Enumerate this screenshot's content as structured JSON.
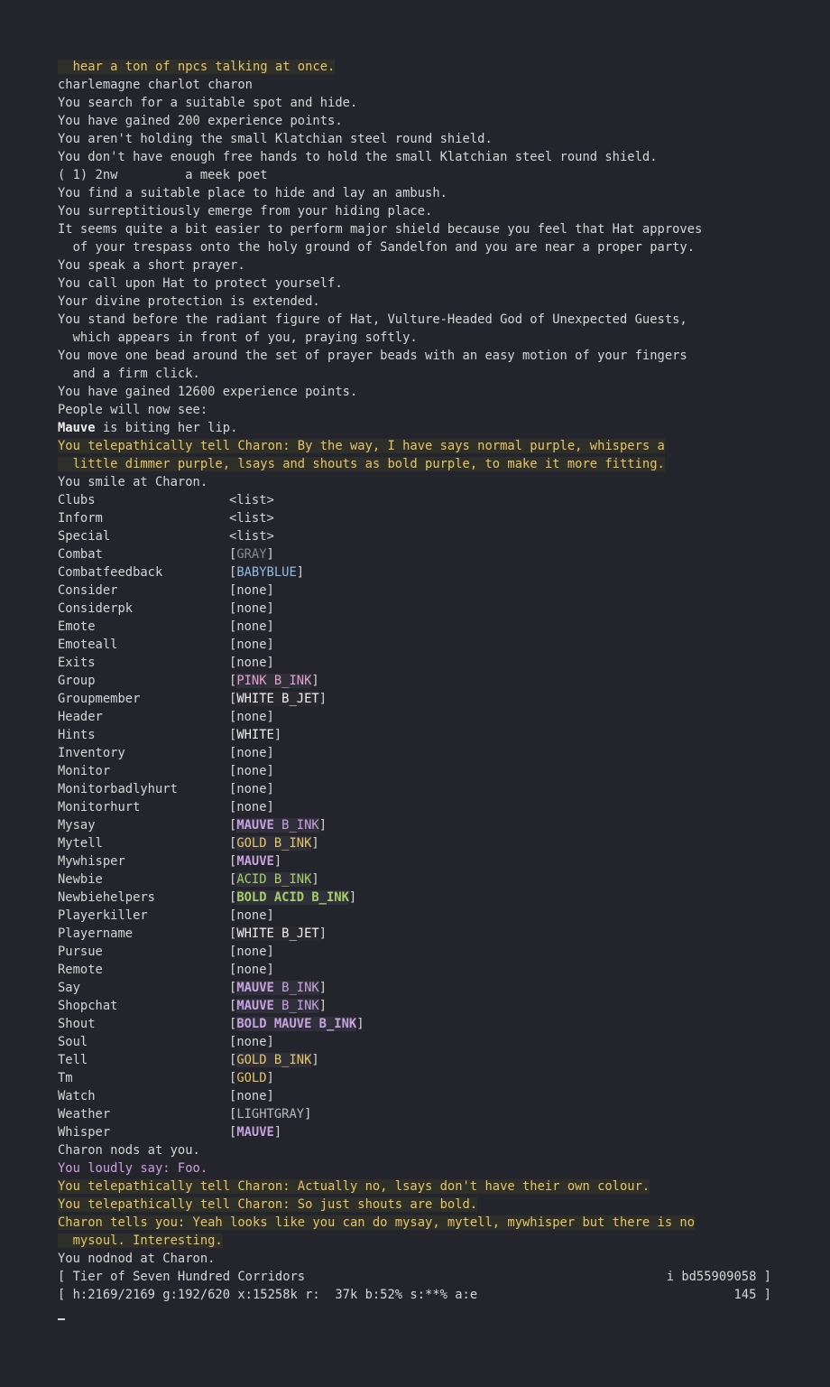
{
  "lines_top": [
    {
      "text": "  hear a ton of npcs talking at once.",
      "cls": "gold hl"
    },
    {
      "text": "charlemagne charlot charon",
      "cls": ""
    },
    {
      "text": "You search for a suitable spot and hide.",
      "cls": ""
    },
    {
      "text": "You have gained 200 experience points.",
      "cls": ""
    },
    {
      "text": "You aren't holding the small Klatchian steel round shield.",
      "cls": ""
    },
    {
      "text": "You don't have enough free hands to hold the small Klatchian steel round shield.",
      "cls": ""
    },
    {
      "text": "( 1) 2nw         a meek poet",
      "cls": ""
    },
    {
      "text": "You find a suitable place to hide and lay an ambush.",
      "cls": ""
    },
    {
      "text": "You surreptitiously emerge from your hiding place.",
      "cls": ""
    },
    {
      "text": "It seems quite a bit easier to perform major shield because you feel that Hat approves",
      "cls": ""
    },
    {
      "text": "  of your trespass onto the holy ground of Sandelfon and you are near a proper party.",
      "cls": ""
    },
    {
      "text": "You speak a short prayer.",
      "cls": ""
    },
    {
      "text": "You call upon Hat to protect yourself.",
      "cls": ""
    },
    {
      "text": "Your divine protection is extended.",
      "cls": ""
    },
    {
      "text": "You stand before the radiant figure of Hat, Vulture-Headed God of Unexpected Guests,",
      "cls": ""
    },
    {
      "text": "  which appears in front of you, praying softly.",
      "cls": ""
    },
    {
      "text": "You move one bead around the set of prayer beads with an easy motion of your fingers",
      "cls": ""
    },
    {
      "text": "  and a firm click.",
      "cls": ""
    },
    {
      "text": "You have gained 12600 experience points.",
      "cls": ""
    },
    {
      "text": "People will now see:",
      "cls": ""
    }
  ],
  "mauve_line": {
    "name": "Mauve",
    "rest": " is biting her lip."
  },
  "lines_mid": [
    {
      "text": "You telepathically tell Charon: By the way, I have says normal purple, whispers a",
      "cls": "gold hl"
    },
    {
      "text": "  little dimmer purple, lsays and shouts as bold purple, to make it more fitting.",
      "cls": "gold hl"
    },
    {
      "text": "You smile at Charon.",
      "cls": ""
    }
  ],
  "config": [
    {
      "name": "Clubs",
      "value": "<list>",
      "cls": "",
      "bracket": false
    },
    {
      "name": "Inform",
      "value": "<list>",
      "cls": "",
      "bracket": false
    },
    {
      "name": "Special",
      "value": "<list>",
      "cls": "",
      "bracket": false
    },
    {
      "name": "Combat",
      "value": "GRAY",
      "cls": "gray",
      "bracket": true
    },
    {
      "name": "Combatfeedback",
      "value": "BABYBLUE",
      "cls": "babyblue",
      "bracket": true
    },
    {
      "name": "Consider",
      "value": "none",
      "cls": "",
      "bracket": true
    },
    {
      "name": "Considerpk",
      "value": "none",
      "cls": "",
      "bracket": true
    },
    {
      "name": "Emote",
      "value": "none",
      "cls": "",
      "bracket": true
    },
    {
      "name": "Emoteall",
      "value": "none",
      "cls": "",
      "bracket": true
    },
    {
      "name": "Exits",
      "value": "none",
      "cls": "",
      "bracket": true
    },
    {
      "name": "Group",
      "value": "PINK B_INK",
      "cls": "pink b_ink",
      "bracket": true
    },
    {
      "name": "Groupmember",
      "value": "WHITE B_JET",
      "cls": "white b_jet",
      "bracket": true
    },
    {
      "name": "Header",
      "value": "none",
      "cls": "",
      "bracket": true
    },
    {
      "name": "Hints",
      "value": "WHITE",
      "cls": "white",
      "bracket": true
    },
    {
      "name": "Inventory",
      "value": "none",
      "cls": "",
      "bracket": true
    },
    {
      "name": "Monitor",
      "value": "none",
      "cls": "",
      "bracket": true
    },
    {
      "name": "Monitorbadlyhurt",
      "value": "none",
      "cls": "",
      "bracket": true
    },
    {
      "name": "Monitorhurt",
      "value": "none",
      "cls": "",
      "bracket": true
    },
    {
      "name": "Mysay",
      "value": "MAUVE B_INK",
      "cls": "mauve b_ink",
      "bracket": true,
      "boldword": "MAUVE"
    },
    {
      "name": "Mytell",
      "value": "GOLD B_INK",
      "cls": "gold b_ink",
      "bracket": true
    },
    {
      "name": "Mywhisper",
      "value": "MAUVE",
      "cls": "mauve",
      "bracket": true,
      "boldword": "MAUVE"
    },
    {
      "name": "Newbie",
      "value": "ACID B_INK",
      "cls": "acid b_ink",
      "bracket": true
    },
    {
      "name": "Newbiehelpers",
      "value": "BOLD ACID B_INK",
      "cls": "acid b_ink bold",
      "bracket": true
    },
    {
      "name": "Playerkiller",
      "value": "none",
      "cls": "",
      "bracket": true
    },
    {
      "name": "Playername",
      "value": "WHITE B_JET",
      "cls": "white b_jet",
      "bracket": true
    },
    {
      "name": "Pursue",
      "value": "none",
      "cls": "",
      "bracket": true
    },
    {
      "name": "Remote",
      "value": "none",
      "cls": "",
      "bracket": true
    },
    {
      "name": "Say",
      "value": "MAUVE B_INK",
      "cls": "mauve b_ink",
      "bracket": true,
      "boldword": "MAUVE"
    },
    {
      "name": "Shopchat",
      "value": "MAUVE B_INK",
      "cls": "mauve b_ink",
      "bracket": true,
      "boldword": "MAUVE"
    },
    {
      "name": "Shout",
      "value": "BOLD MAUVE B_INK",
      "cls": "mauve b_ink bold",
      "bracket": true
    },
    {
      "name": "Soul",
      "value": "none",
      "cls": "",
      "bracket": true
    },
    {
      "name": "Tell",
      "value": "GOLD B_INK",
      "cls": "gold b_ink",
      "bracket": true
    },
    {
      "name": "Tm",
      "value": "GOLD",
      "cls": "gold",
      "bracket": true
    },
    {
      "name": "Watch",
      "value": "none",
      "cls": "",
      "bracket": true
    },
    {
      "name": "Weather",
      "value": "LIGHTGRAY",
      "cls": "lgray",
      "bracket": true
    },
    {
      "name": "Whisper",
      "value": "MAUVE",
      "cls": "mauve",
      "bracket": true,
      "boldword": "MAUVE"
    }
  ],
  "lines_bottom": [
    {
      "text": "Charon nods at you.",
      "cls": ""
    },
    {
      "text": "You loudly say: Foo.",
      "cls": "mauve"
    },
    {
      "text": "You telepathically tell Charon: Actually no, lsays don't have their own colour.",
      "cls": "gold hl"
    },
    {
      "text": "You telepathically tell Charon: So just shouts are bold.",
      "cls": "gold hl"
    },
    {
      "text": "Charon tells you: Yeah looks like you can do mysay, mytell, mywhisper but there is no",
      "cls": "gold hl"
    },
    {
      "text": "  mysoul. Interesting.",
      "cls": "gold hl"
    },
    {
      "text": "You nodnod at Charon.",
      "cls": ""
    }
  ],
  "status": {
    "location": "[ Tier of Seven Hundred Corridors",
    "id": "i bd55909058 ]",
    "stats": "[ h:2169/2169 g:192/620 x:15258k r:  37k b:52% s:**% a:e",
    "count": "145 ]"
  },
  "prompt": {
    "cursor": "_"
  }
}
